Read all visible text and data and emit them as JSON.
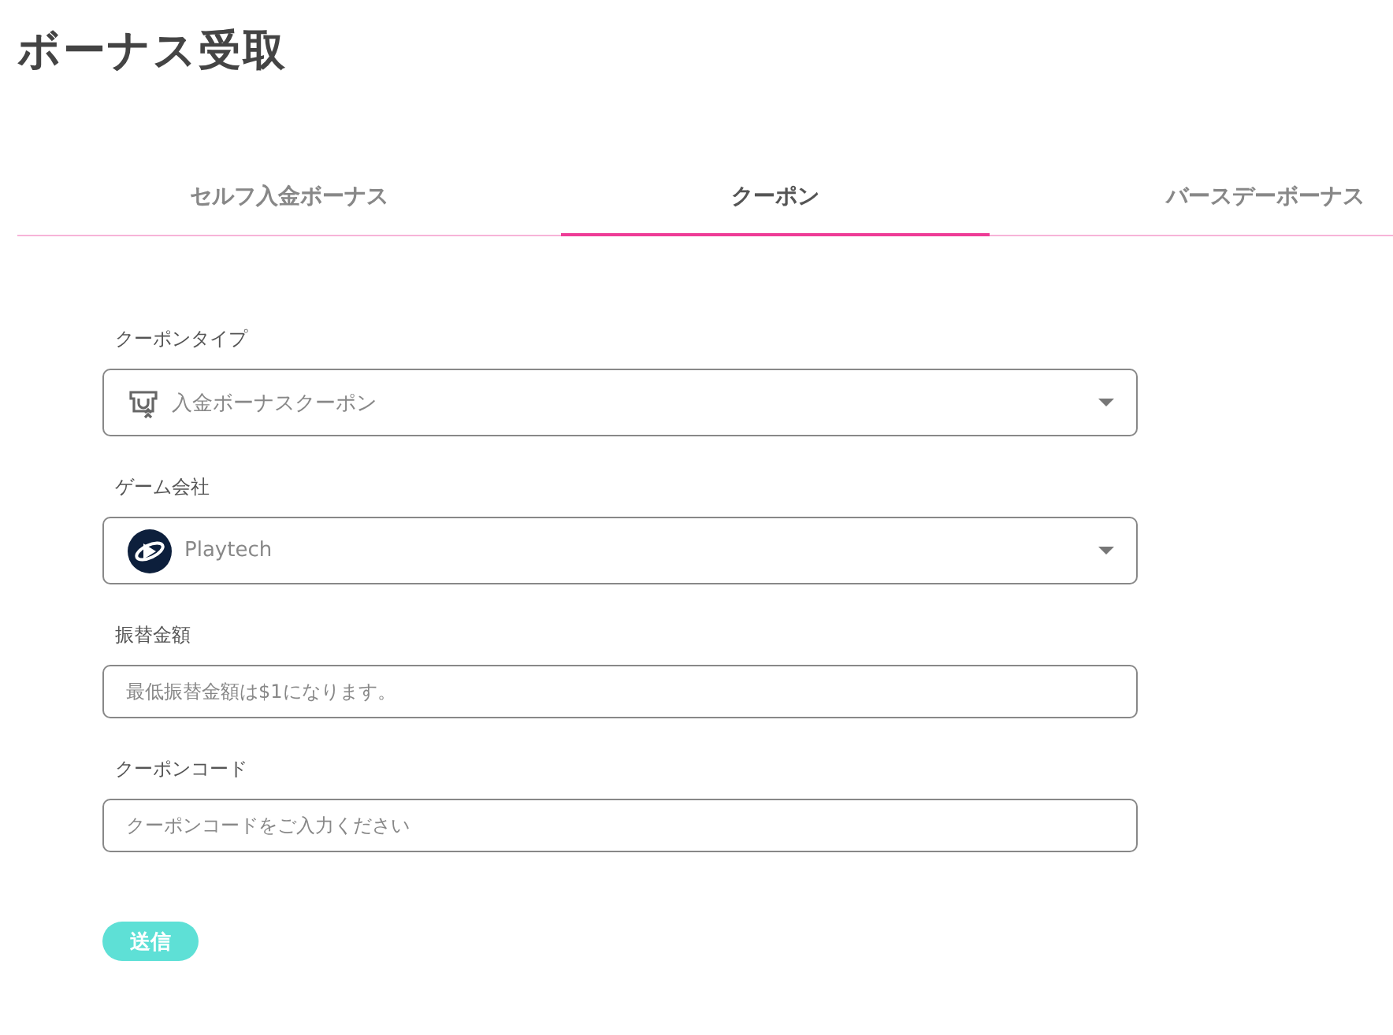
{
  "title": "ボーナス受取",
  "tabs": [
    {
      "label": "セルフ入金ボーナス",
      "selected": false
    },
    {
      "label": "クーポン",
      "selected": true
    },
    {
      "label": "バースデーボーナス",
      "selected": false
    }
  ],
  "fields": [
    {
      "kind": "select",
      "label": "クーポンタイプ",
      "value": "入金ボーナスクーポン"
    },
    {
      "kind": "select",
      "label": "ゲーム会社",
      "value": "Playtech"
    },
    {
      "kind": "input",
      "label": "振替金額",
      "placeholder": "最低振替金額は$1になります。"
    },
    {
      "kind": "input",
      "label": "クーポンコード",
      "placeholder": "クーポンコードをご入力ください"
    }
  ],
  "submit": "送信"
}
